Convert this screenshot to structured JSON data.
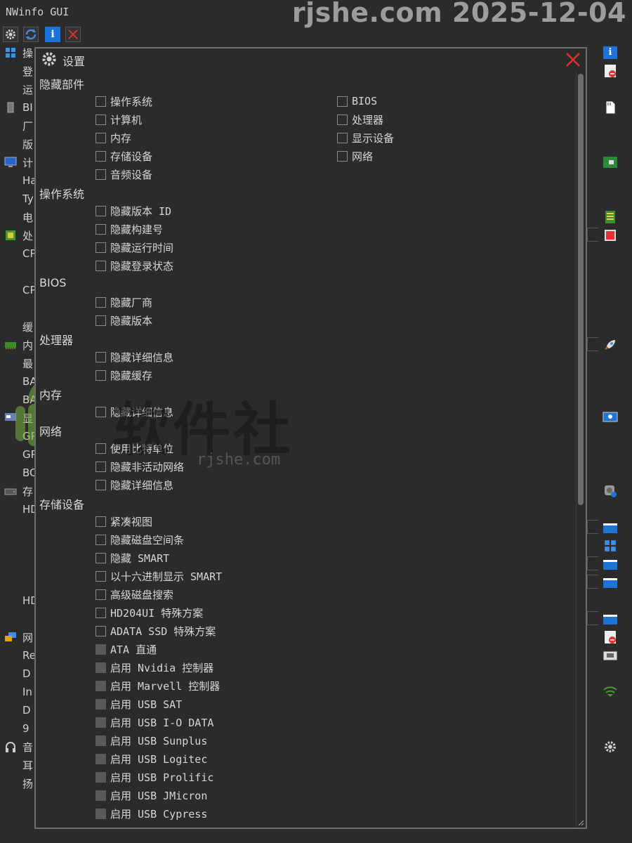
{
  "window": {
    "title": "NWinfo GUI",
    "watermark": "rjshe.com 2025-12-04"
  },
  "toolbar": {
    "buttons": [
      "gear-icon",
      "refresh-icon",
      "info-icon",
      "close-icon"
    ]
  },
  "background_tree": [
    {
      "icon": "windows-icon",
      "text": "操"
    },
    {
      "icon": "",
      "text": "登"
    },
    {
      "icon": "",
      "text": "运"
    },
    {
      "icon": "chip-icon",
      "text": "BI"
    },
    {
      "icon": "",
      "text": "厂"
    },
    {
      "icon": "",
      "text": "版"
    },
    {
      "icon": "monitor-icon",
      "text": "计"
    },
    {
      "icon": "",
      "text": "Ha"
    },
    {
      "icon": "",
      "text": "Ty"
    },
    {
      "icon": "",
      "text": "电"
    },
    {
      "icon": "cpu-icon",
      "text": "处"
    },
    {
      "icon": "",
      "text": "CP"
    },
    {
      "icon": "",
      "text": ""
    },
    {
      "icon": "",
      "text": "CP"
    },
    {
      "icon": "",
      "text": ""
    },
    {
      "icon": "",
      "text": "缓"
    },
    {
      "icon": "memory-icon",
      "text": "内"
    },
    {
      "icon": "",
      "text": "最"
    },
    {
      "icon": "",
      "text": "BA"
    },
    {
      "icon": "",
      "text": "BA"
    },
    {
      "icon": "display-icon",
      "text": "显"
    },
    {
      "icon": "",
      "text": "GP"
    },
    {
      "icon": "",
      "text": "GP"
    },
    {
      "icon": "",
      "text": "BO"
    },
    {
      "icon": "disk-icon",
      "text": "存"
    },
    {
      "icon": "",
      "text": "HD"
    },
    {
      "icon": "",
      "text": ""
    },
    {
      "icon": "",
      "text": ""
    },
    {
      "icon": "",
      "text": ""
    },
    {
      "icon": "",
      "text": ""
    },
    {
      "icon": "",
      "text": "HD"
    },
    {
      "icon": "",
      "text": ""
    },
    {
      "icon": "network-icon",
      "text": "网"
    },
    {
      "icon": "",
      "text": "Re"
    },
    {
      "icon": "",
      "text": " D"
    },
    {
      "icon": "",
      "text": "In"
    },
    {
      "icon": "",
      "text": " D"
    },
    {
      "icon": "",
      "text": " 9"
    },
    {
      "icon": "headphones-icon",
      "text": "音"
    },
    {
      "icon": "",
      "text": "耳"
    },
    {
      "icon": "",
      "text": "扬"
    }
  ],
  "dialog": {
    "title": "设置",
    "sections": [
      {
        "title": "隐藏部件",
        "options": [
          {
            "label": "操作系统",
            "checked": false,
            "disabled": false
          },
          {
            "label": "计算机",
            "checked": false,
            "disabled": false
          },
          {
            "label": "内存",
            "checked": false,
            "disabled": false
          },
          {
            "label": "存储设备",
            "checked": false,
            "disabled": false
          },
          {
            "label": "音频设备",
            "checked": false,
            "disabled": false
          }
        ],
        "options_col2": [
          {
            "label": "BIOS",
            "checked": false,
            "disabled": false
          },
          {
            "label": "处理器",
            "checked": false,
            "disabled": false
          },
          {
            "label": "显示设备",
            "checked": false,
            "disabled": false
          },
          {
            "label": "网络",
            "checked": false,
            "disabled": false
          }
        ]
      },
      {
        "title": "操作系统",
        "options": [
          {
            "label": "隐藏版本 ID",
            "checked": false,
            "disabled": false
          },
          {
            "label": "隐藏构建号",
            "checked": false,
            "disabled": false
          },
          {
            "label": "隐藏运行时间",
            "checked": false,
            "disabled": false
          },
          {
            "label": "隐藏登录状态",
            "checked": false,
            "disabled": false
          }
        ]
      },
      {
        "title": "BIOS",
        "options": [
          {
            "label": "隐藏厂商",
            "checked": false,
            "disabled": false
          },
          {
            "label": "隐藏版本",
            "checked": false,
            "disabled": false
          }
        ]
      },
      {
        "title": "处理器",
        "options": [
          {
            "label": "隐藏详细信息",
            "checked": false,
            "disabled": false
          },
          {
            "label": "隐藏缓存",
            "checked": false,
            "disabled": false
          }
        ]
      },
      {
        "title": "内存",
        "options": [
          {
            "label": "隐藏详细信息",
            "checked": false,
            "disabled": false
          }
        ]
      },
      {
        "title": "网络",
        "options": [
          {
            "label": "使用比特单位",
            "checked": false,
            "disabled": false
          },
          {
            "label": "隐藏非活动网络",
            "checked": false,
            "disabled": false
          },
          {
            "label": "隐藏详细信息",
            "checked": false,
            "disabled": false
          }
        ]
      },
      {
        "title": "存储设备",
        "options": [
          {
            "label": "紧凑视图",
            "checked": false,
            "disabled": false
          },
          {
            "label": "隐藏磁盘空间条",
            "checked": false,
            "disabled": false
          },
          {
            "label": "隐藏 SMART",
            "checked": false,
            "disabled": false
          },
          {
            "label": "以十六进制显示 SMART",
            "checked": false,
            "disabled": false
          },
          {
            "label": "高级磁盘搜索",
            "checked": false,
            "disabled": false
          },
          {
            "label": "HD204UI 特殊方案",
            "checked": false,
            "disabled": false
          },
          {
            "label": "ADATA SSD 特殊方案",
            "checked": false,
            "disabled": false
          },
          {
            "label": "ATA 直通",
            "checked": false,
            "disabled": true
          },
          {
            "label": "启用 Nvidia 控制器",
            "checked": false,
            "disabled": true
          },
          {
            "label": "启用 Marvell 控制器",
            "checked": false,
            "disabled": true
          },
          {
            "label": "启用 USB SAT",
            "checked": false,
            "disabled": true
          },
          {
            "label": "启用 USB I-O DATA",
            "checked": false,
            "disabled": true
          },
          {
            "label": "启用 USB Sunplus",
            "checked": false,
            "disabled": true
          },
          {
            "label": "启用 USB Logitec",
            "checked": false,
            "disabled": true
          },
          {
            "label": "启用 USB Prolific",
            "checked": false,
            "disabled": true
          },
          {
            "label": "启用 USB JMicron",
            "checked": false,
            "disabled": true
          },
          {
            "label": "启用 USB Cypress",
            "checked": false,
            "disabled": true
          }
        ]
      }
    ]
  },
  "right_icons": [
    "info-icon",
    "error-page-icon",
    "sd-card-icon",
    "motherboard-icon",
    "memory-stick-icon",
    "red-chip-icon",
    "rocket-icon",
    "monitor-info-icon",
    "disk-info-icon",
    "folder-icon",
    "windows-icon",
    "folder-icon",
    "folder-icon",
    "folder-icon",
    "error-page-icon",
    "ethernet-icon",
    "wifi-icon",
    "gear-icon"
  ],
  "watermark_center": {
    "title": "软件社",
    "subtitle": "rjshe.com"
  },
  "colors": {
    "background": "#2b2b2b",
    "border": "#6e6e6e",
    "close_red": "#e03030",
    "accent_blue": "#1e73d8"
  }
}
